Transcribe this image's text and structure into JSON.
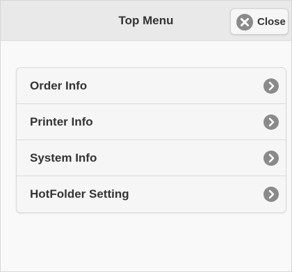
{
  "header": {
    "title": "Top Menu",
    "close_label": "Close",
    "close_icon": "close-icon"
  },
  "menu": {
    "items": [
      {
        "label": "Order Info",
        "icon": "chevron-right-icon"
      },
      {
        "label": "Printer Info",
        "icon": "chevron-right-icon"
      },
      {
        "label": "System Info",
        "icon": "chevron-right-icon"
      },
      {
        "label": "HotFolder Setting",
        "icon": "chevron-right-icon"
      }
    ]
  },
  "colors": {
    "header_bg": "#e9e9e9",
    "page_bg": "#f9f9f9",
    "icon_fill": "#8a8a8a",
    "text": "#333333"
  }
}
